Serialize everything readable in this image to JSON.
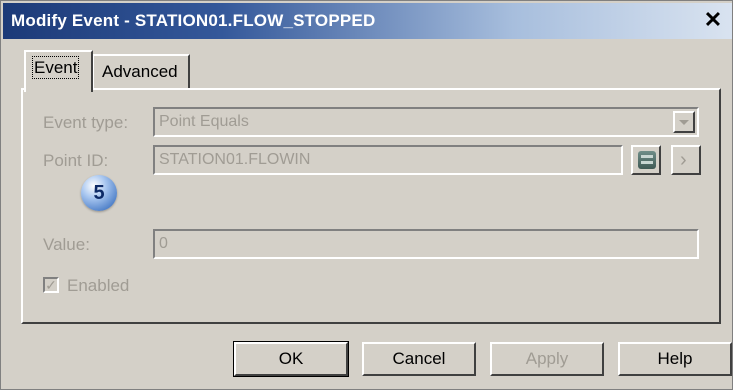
{
  "window": {
    "title": "Modify Event - STATION01.FLOW_STOPPED",
    "close_glyph": "✕"
  },
  "tabs": [
    {
      "label": "Event",
      "selected": true
    },
    {
      "label": "Advanced",
      "selected": false
    }
  ],
  "form": {
    "event_type": {
      "label": "Event type:",
      "value": "Point Equals"
    },
    "point_id": {
      "label": "Point ID:",
      "value": "STATION01.FLOWIN"
    },
    "value": {
      "label": "Value:",
      "value": "0"
    },
    "enabled": {
      "label": "Enabled",
      "checked": true,
      "check_glyph": "✓"
    }
  },
  "callout": {
    "number": "5"
  },
  "buttons": {
    "ok": "OK",
    "cancel": "Cancel",
    "apply": "Apply",
    "help": "Help"
  },
  "icons": {
    "point_browser": "database-icon",
    "more": "chevron-right-icon"
  },
  "colors": {
    "title_gradient_start": "#1c3a78",
    "disabled_text": "#a09c94",
    "callout_blue": "#4a7cc6"
  }
}
